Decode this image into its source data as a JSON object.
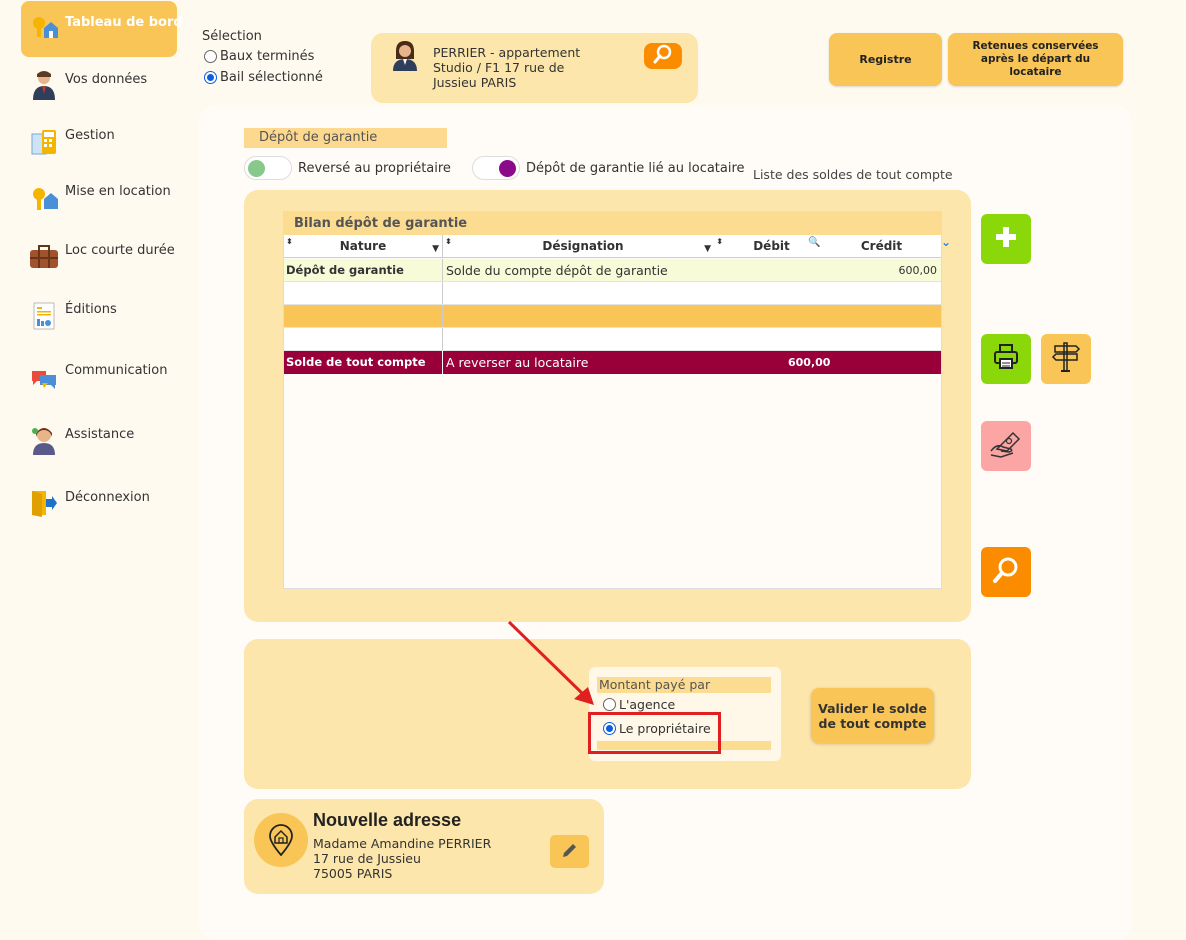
{
  "sidebar": {
    "items": [
      {
        "label": "Tableau de bord",
        "icon": "house-key-icon"
      },
      {
        "label": "Vos données",
        "icon": "user-icon"
      },
      {
        "label": "Gestion",
        "icon": "calculator-icon"
      },
      {
        "label": "Mise en location",
        "icon": "key-house-icon"
      },
      {
        "label": "Loc courte durée",
        "icon": "suitcase-icon"
      },
      {
        "label": "Éditions",
        "icon": "document-chart-icon"
      },
      {
        "label": "Communication",
        "icon": "chat-bubbles-icon"
      },
      {
        "label": "Assistance",
        "icon": "support-agent-icon"
      },
      {
        "label": "Déconnexion",
        "icon": "exit-door-icon"
      }
    ]
  },
  "selection": {
    "title": "Sélection",
    "option1": "Baux terminés",
    "option2": "Bail sélectionné",
    "selected": "Bail sélectionné"
  },
  "lease": {
    "line1": "PERRIER - appartement",
    "line2": "Studio / F1 17 rue de",
    "line3": "Jussieu PARIS"
  },
  "top_buttons": {
    "registre": "Registre",
    "retenues": "Retenues conservées après le départ du locataire"
  },
  "deposit": {
    "tab": "Dépôt de garantie",
    "toggle1": "Reversé au propriétaire",
    "toggle2": "Dépôt de garantie lié au locataire",
    "list_label": "Liste des soldes de tout compte"
  },
  "table": {
    "title": "Bilan dépôt de garantie",
    "headers": {
      "nature": "Nature",
      "designation": "Désignation",
      "debit": "Débit",
      "credit": "Crédit"
    },
    "row1": {
      "nature": "Dépôt de garantie",
      "designation": "Solde du compte dépôt de garantie",
      "debit": "",
      "credit": "600,00"
    },
    "total": {
      "nature": "Solde de tout compte",
      "designation": "A reverser au locataire",
      "debit": "600,00",
      "credit": ""
    }
  },
  "payment": {
    "title": "Montant payé par",
    "option1": "L'agence",
    "option2": "Le propriétaire",
    "selected": "Le propriétaire",
    "validate": "Valider le solde de tout compte"
  },
  "address": {
    "title": "Nouvelle adresse",
    "name": "Madame Amandine PERRIER",
    "street": "17 rue de Jussieu",
    "city": "75005 PARIS"
  },
  "colors": {
    "accent": "#f9c557",
    "panel": "#fce6ab",
    "total_row": "#99003a",
    "green": "#8bd80a",
    "orange": "#fb8c00",
    "annotation": "#e02020"
  }
}
